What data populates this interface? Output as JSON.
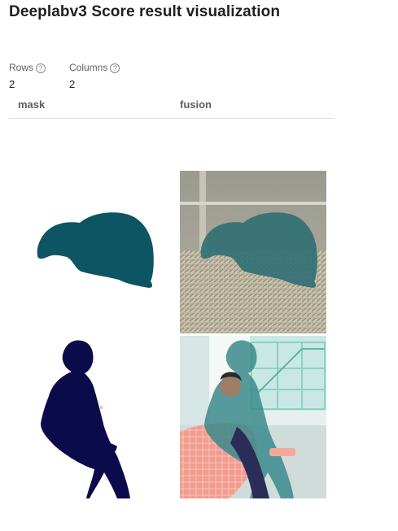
{
  "page": {
    "title": "Deeplabv3 Score result visualization"
  },
  "table_meta": {
    "rows_label": "Rows",
    "rows_value": "2",
    "columns_label": "Columns",
    "columns_value": "2",
    "info_glyph": "?"
  },
  "columns": [
    "mask",
    "fusion"
  ],
  "rows": [
    {
      "mask": "sheep-mask-image",
      "fusion": "sheep-fusion-image"
    },
    {
      "mask": "person-mask-image",
      "fusion": "person-fusion-image"
    }
  ],
  "colors": {
    "sheep_mask": "#0e5564",
    "person_mask": "#0b0a4a",
    "fusion_tint": "#3b8a8c"
  },
  "watermark": "#"
}
